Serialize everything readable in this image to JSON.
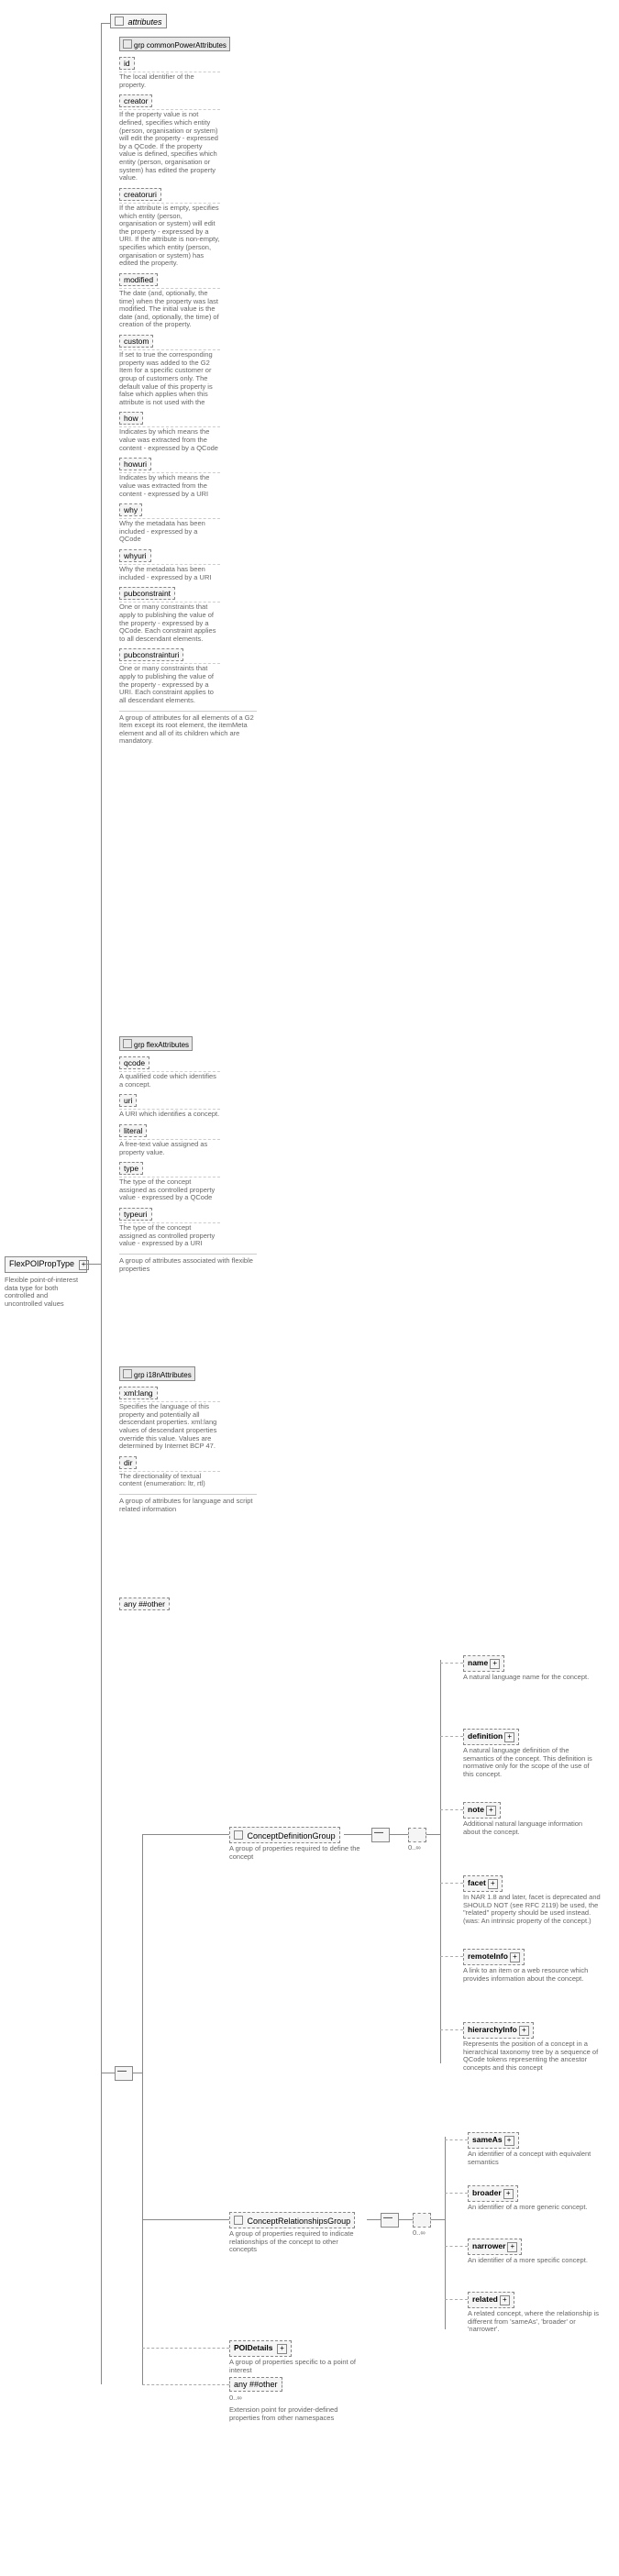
{
  "root": {
    "name": "FlexPOIPropType",
    "desc": "Flexible point-of-interest data type for both controlled and uncontrolled values"
  },
  "attributes_header": "attributes",
  "commonPower": {
    "label": "grp commonPowerAttributes",
    "footer": "A group of attributes for all elements of a G2 Item except its root element, the itemMeta element and all of its children which are mandatory.",
    "items": [
      {
        "name": "id",
        "desc": "The local identifier of the property."
      },
      {
        "name": "creator",
        "desc": "If the property value is not defined, specifies which entity (person, organisation or system) will edit the property - expressed by a QCode. If the property value is defined, specifies which entity (person, organisation or system) has edited the property value."
      },
      {
        "name": "creatoruri",
        "desc": "If the attribute is empty, specifies which entity (person, organisation or system) will edit the property - expressed by a URI. If the attribute is non-empty, specifies which entity (person, organisation or system) has edited the property."
      },
      {
        "name": "modified",
        "desc": "The date (and, optionally, the time) when the property was last modified. The initial value is the date (and, optionally, the time) of creation of the property."
      },
      {
        "name": "custom",
        "desc": "If set to true the corresponding property was added to the G2 Item for a specific customer or group of customers only. The default value of this property is false which applies when this attribute is not used with the"
      },
      {
        "name": "how",
        "desc": "Indicates by which means the value was extracted from the content - expressed by a QCode"
      },
      {
        "name": "howuri",
        "desc": "Indicates by which means the value was extracted from the content - expressed by a URI"
      },
      {
        "name": "why",
        "desc": "Why the metadata has been included - expressed by a QCode"
      },
      {
        "name": "whyuri",
        "desc": "Why the metadata has been included - expressed by a URI"
      },
      {
        "name": "pubconstraint",
        "desc": "One or many constraints that apply to publishing the value of the property - expressed by a QCode. Each constraint applies to all descendant elements."
      },
      {
        "name": "pubconstrainturi",
        "desc": "One or many constraints that apply to publishing the value of the property - expressed by a URI. Each constraint applies to all descendant elements."
      }
    ]
  },
  "flexAttr": {
    "label": "grp flexAttributes",
    "footer": "A group of attributes associated with flexible properties",
    "items": [
      {
        "name": "qcode",
        "desc": "A qualified code which identifies a concept."
      },
      {
        "name": "uri",
        "desc": "A URI which identifies a concept."
      },
      {
        "name": "literal",
        "desc": "A free-text value assigned as property value."
      },
      {
        "name": "type",
        "desc": "The type of the concept assigned as controlled property value - expressed by a QCode"
      },
      {
        "name": "typeuri",
        "desc": "The type of the concept assigned as controlled property value - expressed by a URI"
      }
    ]
  },
  "i18nAttr": {
    "label": "grp i18nAttributes",
    "footer": "A group of attributes for language and script related information",
    "items": [
      {
        "name": "xml:lang",
        "desc": "Specifies the language of this property and potentially all descendant properties. xml:lang values of descendant properties override this value. Values are determined by Internet BCP 47."
      },
      {
        "name": "dir",
        "desc": "The directionality of textual content (enumeration: ltr, rtl)"
      }
    ]
  },
  "anyAttr": "any ##other",
  "conceptDef": {
    "label": "ConceptDefinitionGroup",
    "desc": "A group of properties required to define the concept",
    "items": [
      {
        "name": "name",
        "desc": "A natural language name for the concept."
      },
      {
        "name": "definition",
        "desc": "A natural language definition of the semantics of the concept. This definition is normative only for the scope of the use of this concept."
      },
      {
        "name": "note",
        "desc": "Additional natural language information about the concept."
      },
      {
        "name": "facet",
        "desc": "In NAR 1.8 and later, facet is deprecated and SHOULD NOT (see RFC 2119) be used, the \"related\" property should be used instead.(was: An intrinsic property of the concept.)"
      },
      {
        "name": "remoteInfo",
        "desc": "A link to an item or a web resource which provides information about the concept."
      },
      {
        "name": "hierarchyInfo",
        "desc": "Represents the position of a concept in a hierarchical taxonomy tree by a sequence of QCode tokens representing the ancestor concepts and this concept"
      }
    ]
  },
  "conceptRel": {
    "label": "ConceptRelationshipsGroup",
    "desc": "A group of properties required to indicate relationships of the concept to other concepts",
    "items": [
      {
        "name": "sameAs",
        "desc": "An identifier of a concept with equivalent semantics"
      },
      {
        "name": "broader",
        "desc": "An identifier of a more generic concept."
      },
      {
        "name": "narrower",
        "desc": "An identifier of a more specific concept."
      },
      {
        "name": "related",
        "desc": "A related concept, where the relationship is different from 'sameAs', 'broader' or 'narrower'."
      }
    ]
  },
  "poiDetails": {
    "name": "POIDetails",
    "desc": "A group of properties specific to a point of interest"
  },
  "anyOther": {
    "label": "any ##other",
    "card": "0..∞",
    "desc": "Extension point for provider-defined properties from other namespaces"
  },
  "card_label": "0..∞"
}
